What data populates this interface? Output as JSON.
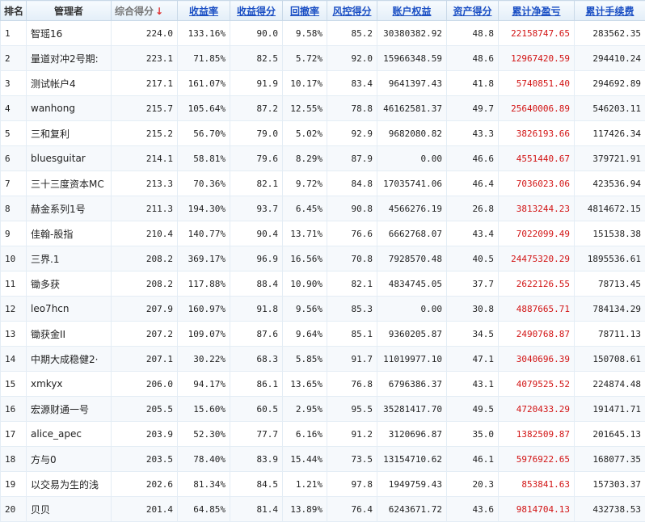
{
  "table": {
    "headers": [
      {
        "label": "排名",
        "sortable": false
      },
      {
        "label": "管理者",
        "sortable": false
      },
      {
        "label": "综合得分",
        "sortable": true,
        "sorted": true
      },
      {
        "label": "收益率",
        "sortable": true
      },
      {
        "label": "收益得分",
        "sortable": true
      },
      {
        "label": "回撤率",
        "sortable": true
      },
      {
        "label": "风控得分",
        "sortable": true
      },
      {
        "label": "账户权益",
        "sortable": true
      },
      {
        "label": "资产得分",
        "sortable": true
      },
      {
        "label": "累计净盈亏",
        "sortable": true
      },
      {
        "label": "累计手续费",
        "sortable": true
      }
    ],
    "sort_arrow": "↓",
    "rows": [
      {
        "rank": "1",
        "manager": "智瑶16",
        "score": "224.0",
        "return_rate": "133.16%",
        "return_score": "90.0",
        "drawdown": "9.58%",
        "risk_score": "85.2",
        "equity": "30380382.92",
        "asset_score": "48.8",
        "net_profit": "22158747.65",
        "fees": "283562.35"
      },
      {
        "rank": "2",
        "manager": "量道对冲2号期:",
        "score": "223.1",
        "return_rate": "71.85%",
        "return_score": "82.5",
        "drawdown": "5.72%",
        "risk_score": "92.0",
        "equity": "15966348.59",
        "asset_score": "48.6",
        "net_profit": "12967420.59",
        "fees": "294410.24"
      },
      {
        "rank": "3",
        "manager": "测试帐户4",
        "score": "217.1",
        "return_rate": "161.07%",
        "return_score": "91.9",
        "drawdown": "10.17%",
        "risk_score": "83.4",
        "equity": "9641397.43",
        "asset_score": "41.8",
        "net_profit": "5740851.40",
        "fees": "294692.89"
      },
      {
        "rank": "4",
        "manager": "wanhong",
        "score": "215.7",
        "return_rate": "105.64%",
        "return_score": "87.2",
        "drawdown": "12.55%",
        "risk_score": "78.8",
        "equity": "46162581.37",
        "asset_score": "49.7",
        "net_profit": "25640006.89",
        "fees": "546203.11"
      },
      {
        "rank": "5",
        "manager": "三和复利",
        "score": "215.2",
        "return_rate": "56.70%",
        "return_score": "79.0",
        "drawdown": "5.02%",
        "risk_score": "92.9",
        "equity": "9682080.82",
        "asset_score": "43.3",
        "net_profit": "3826193.66",
        "fees": "117426.34"
      },
      {
        "rank": "6",
        "manager": "bluesguitar",
        "score": "214.1",
        "return_rate": "58.81%",
        "return_score": "79.6",
        "drawdown": "8.29%",
        "risk_score": "87.9",
        "equity": "0.00",
        "asset_score": "46.6",
        "net_profit": "4551440.67",
        "fees": "379721.91"
      },
      {
        "rank": "7",
        "manager": "三十三度资本MC",
        "score": "213.3",
        "return_rate": "70.36%",
        "return_score": "82.1",
        "drawdown": "9.72%",
        "risk_score": "84.8",
        "equity": "17035741.06",
        "asset_score": "46.4",
        "net_profit": "7036023.06",
        "fees": "423536.94"
      },
      {
        "rank": "8",
        "manager": "赫金系列1号",
        "score": "211.3",
        "return_rate": "194.30%",
        "return_score": "93.7",
        "drawdown": "6.45%",
        "risk_score": "90.8",
        "equity": "4566276.19",
        "asset_score": "26.8",
        "net_profit": "3813244.23",
        "fees": "4814672.15"
      },
      {
        "rank": "9",
        "manager": "佳翰-股指",
        "score": "210.4",
        "return_rate": "140.77%",
        "return_score": "90.4",
        "drawdown": "13.71%",
        "risk_score": "76.6",
        "equity": "6662768.07",
        "asset_score": "43.4",
        "net_profit": "7022099.49",
        "fees": "151538.38"
      },
      {
        "rank": "10",
        "manager": "三界.1",
        "score": "208.2",
        "return_rate": "369.17%",
        "return_score": "96.9",
        "drawdown": "16.56%",
        "risk_score": "70.8",
        "equity": "7928570.48",
        "asset_score": "40.5",
        "net_profit": "24475320.29",
        "fees": "1895536.61"
      },
      {
        "rank": "11",
        "manager": "锄多获",
        "score": "208.2",
        "return_rate": "117.88%",
        "return_score": "88.4",
        "drawdown": "10.90%",
        "risk_score": "82.1",
        "equity": "4834745.05",
        "asset_score": "37.7",
        "net_profit": "2622126.55",
        "fees": "78713.45"
      },
      {
        "rank": "12",
        "manager": "leo7hcn",
        "score": "207.9",
        "return_rate": "160.97%",
        "return_score": "91.8",
        "drawdown": "9.56%",
        "risk_score": "85.3",
        "equity": "0.00",
        "asset_score": "30.8",
        "net_profit": "4887665.71",
        "fees": "784134.29"
      },
      {
        "rank": "13",
        "manager": "锄获金II",
        "score": "207.2",
        "return_rate": "109.07%",
        "return_score": "87.6",
        "drawdown": "9.64%",
        "risk_score": "85.1",
        "equity": "9360205.87",
        "asset_score": "34.5",
        "net_profit": "2490768.87",
        "fees": "78711.13"
      },
      {
        "rank": "14",
        "manager": "中期大成稳健2·",
        "score": "207.1",
        "return_rate": "30.22%",
        "return_score": "68.3",
        "drawdown": "5.85%",
        "risk_score": "91.7",
        "equity": "11019977.10",
        "asset_score": "47.1",
        "net_profit": "3040696.39",
        "fees": "150708.61"
      },
      {
        "rank": "15",
        "manager": "xmkyx",
        "score": "206.0",
        "return_rate": "94.17%",
        "return_score": "86.1",
        "drawdown": "13.65%",
        "risk_score": "76.8",
        "equity": "6796386.37",
        "asset_score": "43.1",
        "net_profit": "4079525.52",
        "fees": "224874.48"
      },
      {
        "rank": "16",
        "manager": "宏源财通一号",
        "score": "205.5",
        "return_rate": "15.60%",
        "return_score": "60.5",
        "drawdown": "2.95%",
        "risk_score": "95.5",
        "equity": "35281417.70",
        "asset_score": "49.5",
        "net_profit": "4720433.29",
        "fees": "191471.71"
      },
      {
        "rank": "17",
        "manager": "alice_apec",
        "score": "203.9",
        "return_rate": "52.30%",
        "return_score": "77.7",
        "drawdown": "6.16%",
        "risk_score": "91.2",
        "equity": "3120696.87",
        "asset_score": "35.0",
        "net_profit": "1382509.87",
        "fees": "201645.13"
      },
      {
        "rank": "18",
        "manager": "方与0",
        "score": "203.5",
        "return_rate": "78.40%",
        "return_score": "83.9",
        "drawdown": "15.44%",
        "risk_score": "73.5",
        "equity": "13154710.62",
        "asset_score": "46.1",
        "net_profit": "5976922.65",
        "fees": "168077.35"
      },
      {
        "rank": "19",
        "manager": "以交易为生的浅",
        "score": "202.6",
        "return_rate": "81.34%",
        "return_score": "84.5",
        "drawdown": "1.21%",
        "risk_score": "97.8",
        "equity": "1949759.43",
        "asset_score": "20.3",
        "net_profit": "853841.63",
        "fees": "157303.37"
      },
      {
        "rank": "20",
        "manager": "贝贝",
        "score": "201.4",
        "return_rate": "64.85%",
        "return_score": "81.4",
        "drawdown": "13.89%",
        "risk_score": "76.4",
        "equity": "6243671.72",
        "asset_score": "43.6",
        "net_profit": "9814704.13",
        "fees": "432738.53"
      }
    ]
  },
  "colors": {
    "header_link": "#1b4fc4",
    "profit": "#d21414",
    "sort_arrow": "#e03030"
  }
}
